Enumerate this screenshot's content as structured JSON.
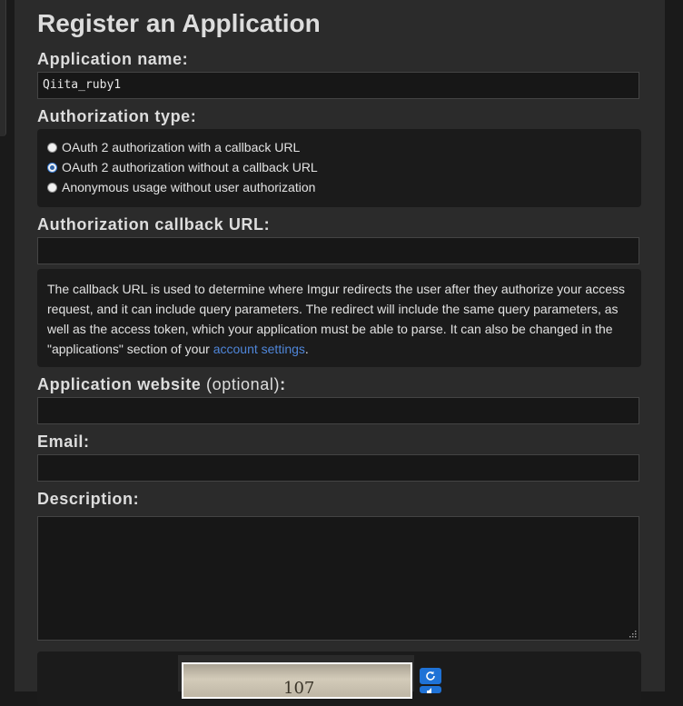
{
  "page": {
    "title": "Register an Application"
  },
  "form": {
    "app_name_label": "Application name:",
    "app_name_value": "Qiita_ruby1",
    "auth_type_label": "Authorization type:",
    "auth_options": [
      {
        "label": "OAuth 2 authorization with a callback URL",
        "checked": false
      },
      {
        "label": "OAuth 2 authorization without a callback URL",
        "checked": true
      },
      {
        "label": "Anonymous usage without user authorization",
        "checked": false
      }
    ],
    "callback_label": "Authorization callback URL:",
    "callback_value": "",
    "callback_info_1": "The callback URL is used to determine where Imgur redirects the user after they authorize your access request, and it can include query parameters. The redirect will include the same query parameters, as well as the access token, which your application must be able to parse. It can also be changed in the \"applications\" section of your ",
    "callback_info_link": "account settings",
    "callback_info_end": ".",
    "website_label": "Application website",
    "website_optional": "(optional)",
    "website_colon": ":",
    "website_value": "",
    "email_label": "Email:",
    "email_value": "",
    "description_label": "Description:",
    "description_value": "",
    "captcha_text": "107"
  },
  "colors": {
    "background": "#1a1a1a",
    "panel": "#2b2b2b",
    "link": "#4f86d9",
    "captcha_button": "#1f72d6"
  },
  "icons": {
    "refresh": "refresh-icon",
    "audio": "audio-icon"
  }
}
